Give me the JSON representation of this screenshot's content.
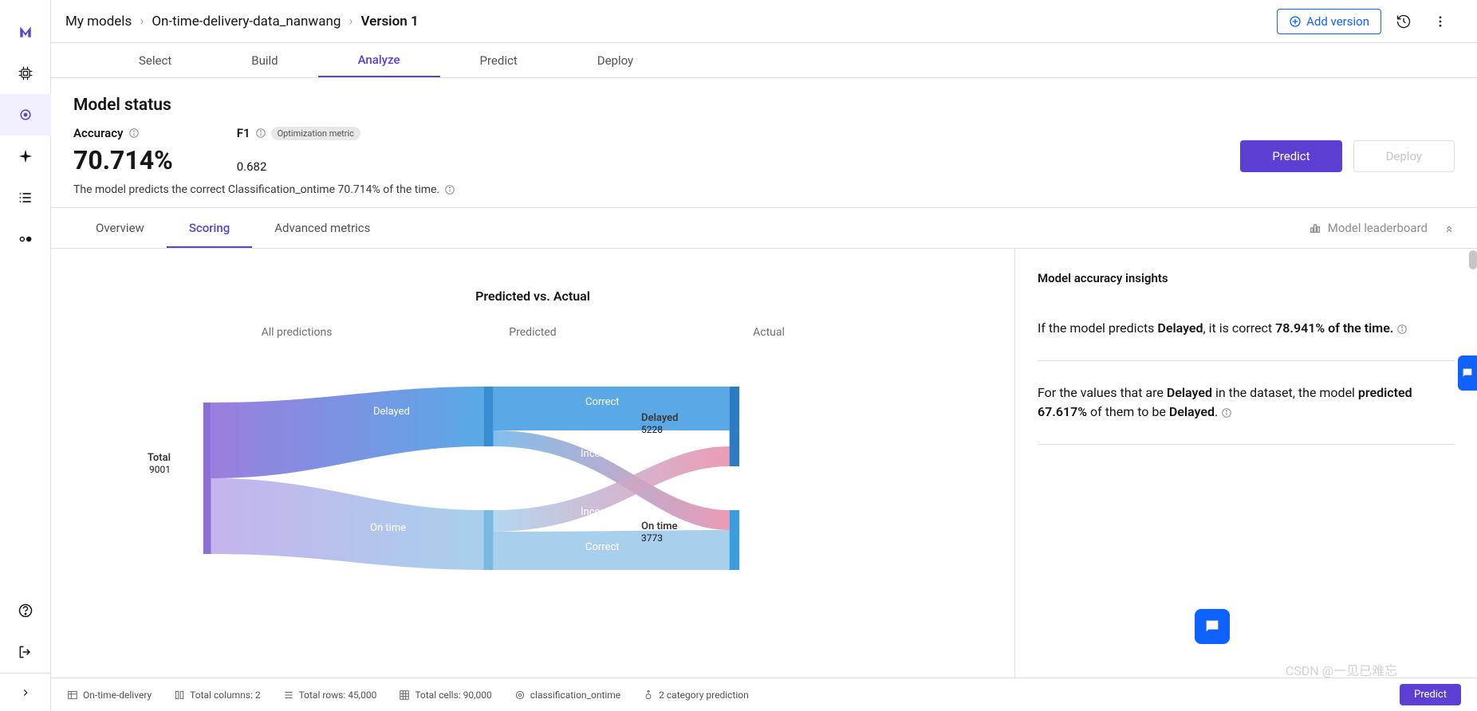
{
  "breadcrumb": {
    "root": "My models",
    "project": "On-time-delivery-data_nanwang",
    "version": "Version 1"
  },
  "topbar": {
    "add_version": "Add version"
  },
  "maintabs": {
    "select": "Select",
    "build": "Build",
    "analyze": "Analyze",
    "predict": "Predict",
    "deploy": "Deploy"
  },
  "status": {
    "title": "Model status",
    "accuracy_lbl": "Accuracy",
    "accuracy_val": "70.714%",
    "f1_lbl": "F1",
    "f1_badge": "Optimization metric",
    "f1_val": "0.682",
    "desc": "The model predicts the correct Classification_ontime 70.714% of the time."
  },
  "actions": {
    "predict": "Predict",
    "deploy": "Deploy"
  },
  "subtabs": {
    "overview": "Overview",
    "scoring": "Scoring",
    "advanced": "Advanced metrics",
    "leaderboard": "Model leaderboard"
  },
  "chart": {
    "title": "Predicted vs. Actual",
    "col_all": "All predictions",
    "col_pred": "Predicted",
    "col_actual": "Actual",
    "total_lbl": "Total",
    "total_val": "9001",
    "pred_delayed": "Delayed",
    "pred_ontime": "On time",
    "correct": "Correct",
    "incorrect": "Incorrect",
    "act_delayed_lbl": "Delayed",
    "act_delayed_val": "5228",
    "act_ontime_lbl": "On time",
    "act_ontime_val": "3773"
  },
  "chart_data": {
    "type": "sankey",
    "title": "Predicted vs. Actual",
    "total": 9001,
    "predicted": [
      {
        "label": "Delayed",
        "splits": [
          {
            "result": "Correct",
            "actual": "Delayed"
          },
          {
            "result": "Incorrect",
            "actual": "On time"
          }
        ]
      },
      {
        "label": "On time",
        "splits": [
          {
            "result": "Incorrect",
            "actual": "Delayed"
          },
          {
            "result": "Correct",
            "actual": "On time"
          }
        ]
      }
    ],
    "actual": [
      {
        "label": "Delayed",
        "count": 5228
      },
      {
        "label": "On time",
        "count": 3773
      }
    ]
  },
  "insights": {
    "title": "Model accuracy insights",
    "i1_a": "If the model predicts ",
    "i1_b": "Delayed",
    "i1_c": ", it is correct ",
    "i1_d": "78.941% of the time.",
    "i2_a": "For the values that are ",
    "i2_b": "Delayed",
    "i2_c": " in the dataset, the model ",
    "i2_d": "predicted 67.617%",
    "i2_e": " of them to be ",
    "i2_f": "Delayed",
    "i2_g": "."
  },
  "bottombar": {
    "ds": "On-time-delivery",
    "cols": "Total columns: 2",
    "rows": "Total rows: 45,000",
    "cells": "Total cells: 90,000",
    "target": "classification_ontime",
    "type": "2 category prediction",
    "predict": "Predict"
  },
  "watermark": "CSDN @一见已难忘"
}
